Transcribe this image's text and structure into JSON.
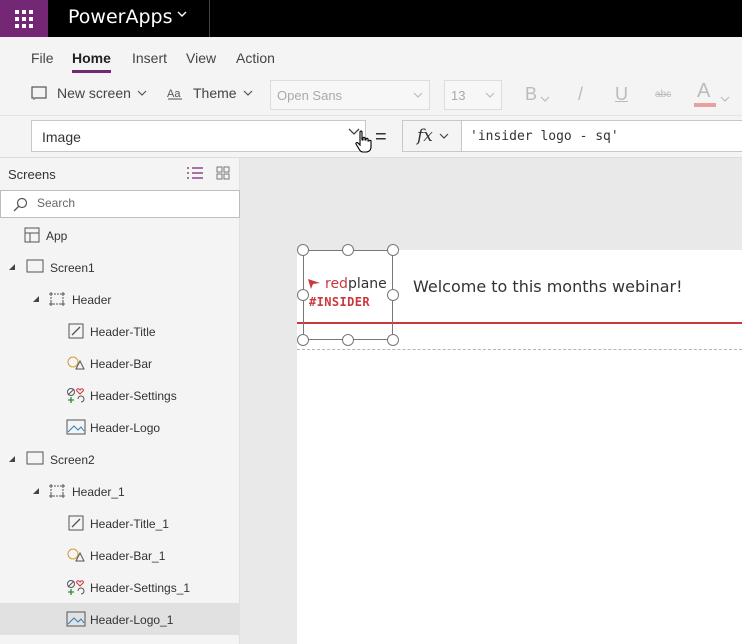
{
  "app": {
    "name": "PowerApps"
  },
  "menu": {
    "tabs": [
      {
        "label": "File"
      },
      {
        "label": "Home"
      },
      {
        "label": "Insert"
      },
      {
        "label": "View"
      },
      {
        "label": "Action"
      }
    ]
  },
  "toolbar": {
    "new_screen": "New screen",
    "theme": "Theme",
    "font": "Open Sans",
    "font_size": "13",
    "bold": "B",
    "italic": "/",
    "underline": "U",
    "strikethrough": "abc",
    "font_color": "A"
  },
  "formula": {
    "property": "Image",
    "equals": "=",
    "fx": "fx",
    "expression": "'insider logo - sq'"
  },
  "panel": {
    "title": "Screens",
    "search_placeholder": "Search",
    "tree": [
      {
        "label": "App",
        "icon": "app-icon"
      },
      {
        "label": "Screen1",
        "icon": "screen-icon",
        "expanded": true
      },
      {
        "label": "Header",
        "icon": "group-icon",
        "expanded": true
      },
      {
        "label": "Header-Title",
        "icon": "label-icon"
      },
      {
        "label": "Header-Bar",
        "icon": "shape-icon"
      },
      {
        "label": "Header-Settings",
        "icon": "icon-control-icon"
      },
      {
        "label": "Header-Logo",
        "icon": "image-icon"
      },
      {
        "label": "Screen2",
        "icon": "screen-icon",
        "expanded": true
      },
      {
        "label": "Header_1",
        "icon": "group-icon",
        "expanded": true
      },
      {
        "label": "Header-Title_1",
        "icon": "label-icon"
      },
      {
        "label": "Header-Bar_1",
        "icon": "shape-icon"
      },
      {
        "label": "Header-Settings_1",
        "icon": "icon-control-icon"
      },
      {
        "label": "Header-Logo_1",
        "icon": "image-icon",
        "selected": true
      }
    ]
  },
  "canvas": {
    "welcome_text": "Welcome to this months webinar!",
    "logo": {
      "brand_red": "red",
      "brand_dark": "plane",
      "tag": "#INSIDER"
    }
  },
  "colors": {
    "accent": "#742774",
    "brand_red": "#c9393e"
  }
}
